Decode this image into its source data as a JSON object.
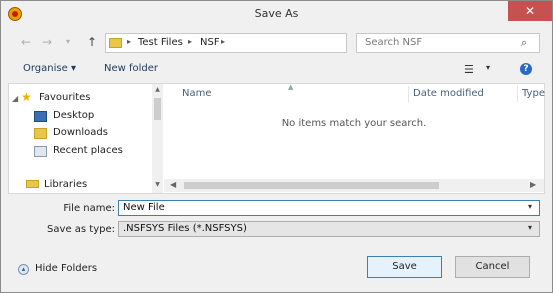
{
  "window": {
    "title": "Save As"
  },
  "address": {
    "crumbs": [
      "Test Files",
      "NSF"
    ]
  },
  "search": {
    "placeholder": "Search NSF"
  },
  "toolbar": {
    "organise_label": "Organise ▾",
    "new_folder_label": "New folder"
  },
  "nav_pane": {
    "items": [
      {
        "label": "Favourites",
        "icon": "star-icon"
      },
      {
        "label": "Desktop",
        "icon": "desktop-icon"
      },
      {
        "label": "Downloads",
        "icon": "downloads-icon"
      },
      {
        "label": "Recent places",
        "icon": "recent-places-icon"
      },
      {
        "label": "Libraries",
        "icon": "libraries-icon"
      }
    ]
  },
  "file_list": {
    "columns": [
      "Name",
      "Date modified",
      "Type"
    ],
    "empty_message": "No items match your search."
  },
  "form": {
    "file_name_label": "File name:",
    "file_name_value": "New File",
    "save_as_type_label": "Save as type:",
    "save_as_type_value": ".NSFSYS Files (*.NSFSYS)"
  },
  "footer": {
    "hide_folders_label": "Hide Folders",
    "save_label": "Save",
    "cancel_label": "Cancel"
  },
  "colors": {
    "close_button": "#c75050",
    "accent": "#3c7fb1"
  }
}
